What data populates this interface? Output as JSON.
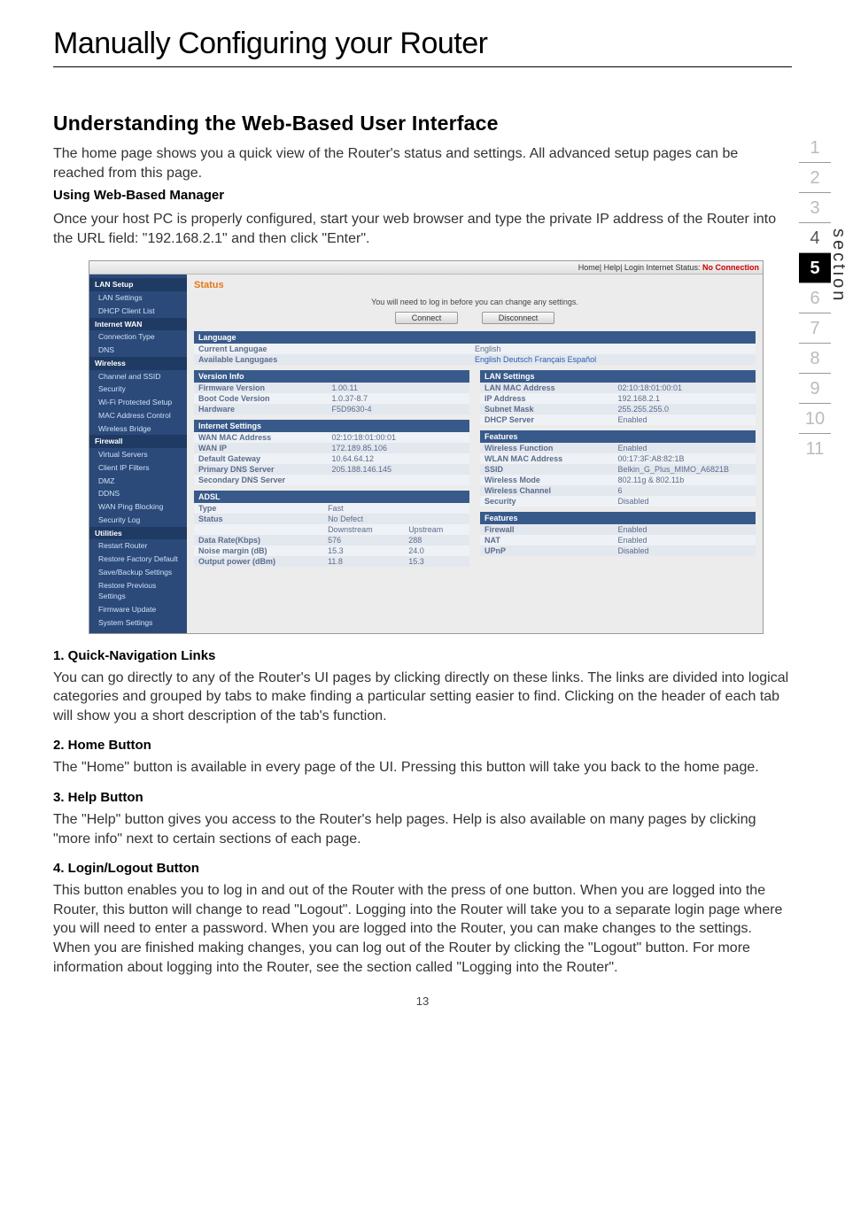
{
  "page": {
    "title": "Manually Configuring your Router",
    "section_heading": "Understanding the Web-Based User Interface",
    "intro": "The home page shows you a quick view of the Router's status and settings. All advanced setup pages can be reached from this page.",
    "using_heading": "Using Web-Based Manager",
    "using_text": "Once your host PC is properly configured, start your web browser and type the private IP address of the Router into the URL field: \"192.168.2.1\" and then click \"Enter\".",
    "items": {
      "n1_h": "1.    Quick-Navigation Links",
      "n1_t": "You can go directly to any of the Router's UI pages by clicking directly on these links. The links are divided into logical categories and grouped by tabs to make finding a particular setting easier to find. Clicking on the header of each tab will show you a short description of the tab's function.",
      "n2_h": "2.   Home Button",
      "n2_t": "The \"Home\" button is available in every page of the UI. Pressing this button will take you back to the home page.",
      "n3_h": "3.   Help Button",
      "n3_t": "The \"Help\" button gives you access to the Router's help pages. Help is also available on many pages by clicking \"more info\" next to certain sections of each page.",
      "n4_h": "4.   Login/Logout Button",
      "n4_t": "This button enables you to log in and out of the Router with the press of one button. When you are logged into the Router, this button will change to read \"Logout\". Logging into the Router will take you to a separate login page where you will need to enter a password. When you are logged into the Router, you can make changes to the settings. When you are finished making changes, you can log out of the Router by clicking the \"Logout\" button. For more information about logging into the Router, see the section called \"Logging into the Router\"."
    },
    "page_number": "13",
    "section_label": "section"
  },
  "nav": {
    "n1": "1",
    "n2": "2",
    "n3": "3",
    "n4": "4",
    "n5": "5",
    "n6": "6",
    "n7": "7",
    "n8": "8",
    "n9": "9",
    "n10": "10",
    "n11": "11"
  },
  "shot": {
    "topbar_left": "Home| Help| Login   Internet Status:",
    "topbar_status": " No Connection",
    "sidebar": {
      "lan_setup": "LAN Setup",
      "lan_settings": "LAN Settings",
      "dhcp_list": "DHCP Client List",
      "internet_wan": "Internet WAN",
      "conn_type": "Connection Type",
      "dns": "DNS",
      "wireless": "Wireless",
      "chan_ssid": "Channel and SSID",
      "security": "Security",
      "wps": "Wi-Fi Protected Setup",
      "mac_ctrl": "MAC Address Control",
      "wbridge": "Wireless Bridge",
      "firewall": "Firewall",
      "vservers": "Virtual Servers",
      "cfilters": "Client IP Filters",
      "dmz": "DMZ",
      "ddns": "DDNS",
      "pingblock": "WAN Ping Blocking",
      "seclog": "Security Log",
      "utilities": "Utilities",
      "restart": "Restart Router",
      "factory": "Restore Factory Default",
      "savebackup": "Save/Backup Settings",
      "restoreprev": "Restore Previous Settings",
      "fwupdate": "Firmware Update",
      "syssettings": "System Settings"
    },
    "main": {
      "status": "Status",
      "hint": "You will need to log in before you can change any settings.",
      "connect": "Connect",
      "disconnect": "Disconnect",
      "language_h": "Language",
      "cur_lang_k": "Current Langugae",
      "cur_lang_v": "English",
      "avail_lang_k": "Available Langugaes",
      "lang_en": "English",
      "lang_de": "Deutsch",
      "lang_fr": "Français",
      "lang_es": "Español",
      "version_h": "Version Info",
      "fw_k": "Firmware Version",
      "fw_v": "1.00.11",
      "boot_k": "Boot Code Version",
      "boot_v": "1.0.37-8.7",
      "hw_k": "Hardware",
      "hw_v": "F5D9630-4",
      "lan_h": "LAN Settings",
      "lanmac_k": "LAN MAC Address",
      "lanmac_v": "02:10:18:01:00:01",
      "ip_k": "IP Address",
      "ip_v": "192.168.2.1",
      "subnet_k": "Subnet Mask",
      "subnet_v": "255.255.255.0",
      "dhcp_k": "DHCP Server",
      "dhcp_v": "Enabled",
      "inet_h": "Internet Settings",
      "wanmac_k": "WAN MAC Address",
      "wanmac_v": "02:10:18:01:00:01",
      "wanip_k": "WAN IP",
      "wanip_v": "172.189.85.106",
      "gw_k": "Default Gateway",
      "gw_v": "10.64.64.12",
      "pdns_k": "Primary DNS Server",
      "pdns_v": "205.188.146.145",
      "sdns_k": "Secondary DNS Server",
      "sdns_v": "",
      "feat_h": "Features",
      "wfunc_k": "Wireless Function",
      "wfunc_v": "Enabled",
      "wlanmac_k": "WLAN MAC Address",
      "wlanmac_v": "00:17:3F:A8:82:1B",
      "ssid_k": "SSID",
      "ssid_v": "Belkin_G_Plus_MIMO_A6821B",
      "wmode_k": "Wireless Mode",
      "wmode_v": "802.11g & 802.11b",
      "wchan_k": "Wireless Channel",
      "wchan_v": "6",
      "wsec_k": "Security",
      "wsec_v": "Disabled",
      "adsl_h": "ADSL",
      "type_k": "Type",
      "type_v": "Fast",
      "stat_k": "Status",
      "stat_v": "No Defect",
      "down_h": "Downstream",
      "up_h": "Upstream",
      "rate_k": "Data Rate(Kbps)",
      "rate_d": "576",
      "rate_u": "288",
      "noise_k": "Noise margin (dB)",
      "noise_d": "15.3",
      "noise_u": "24.0",
      "out_k": "Output power (dBm)",
      "out_d": "11.8",
      "out_u": "15.3",
      "feat2_h": "Features",
      "fw2_k": "Firewall",
      "fw2_v": "Enabled",
      "nat_k": "NAT",
      "nat_v": "Enabled",
      "upnp_k": "UPnP",
      "upnp_v": "Disabled"
    }
  }
}
